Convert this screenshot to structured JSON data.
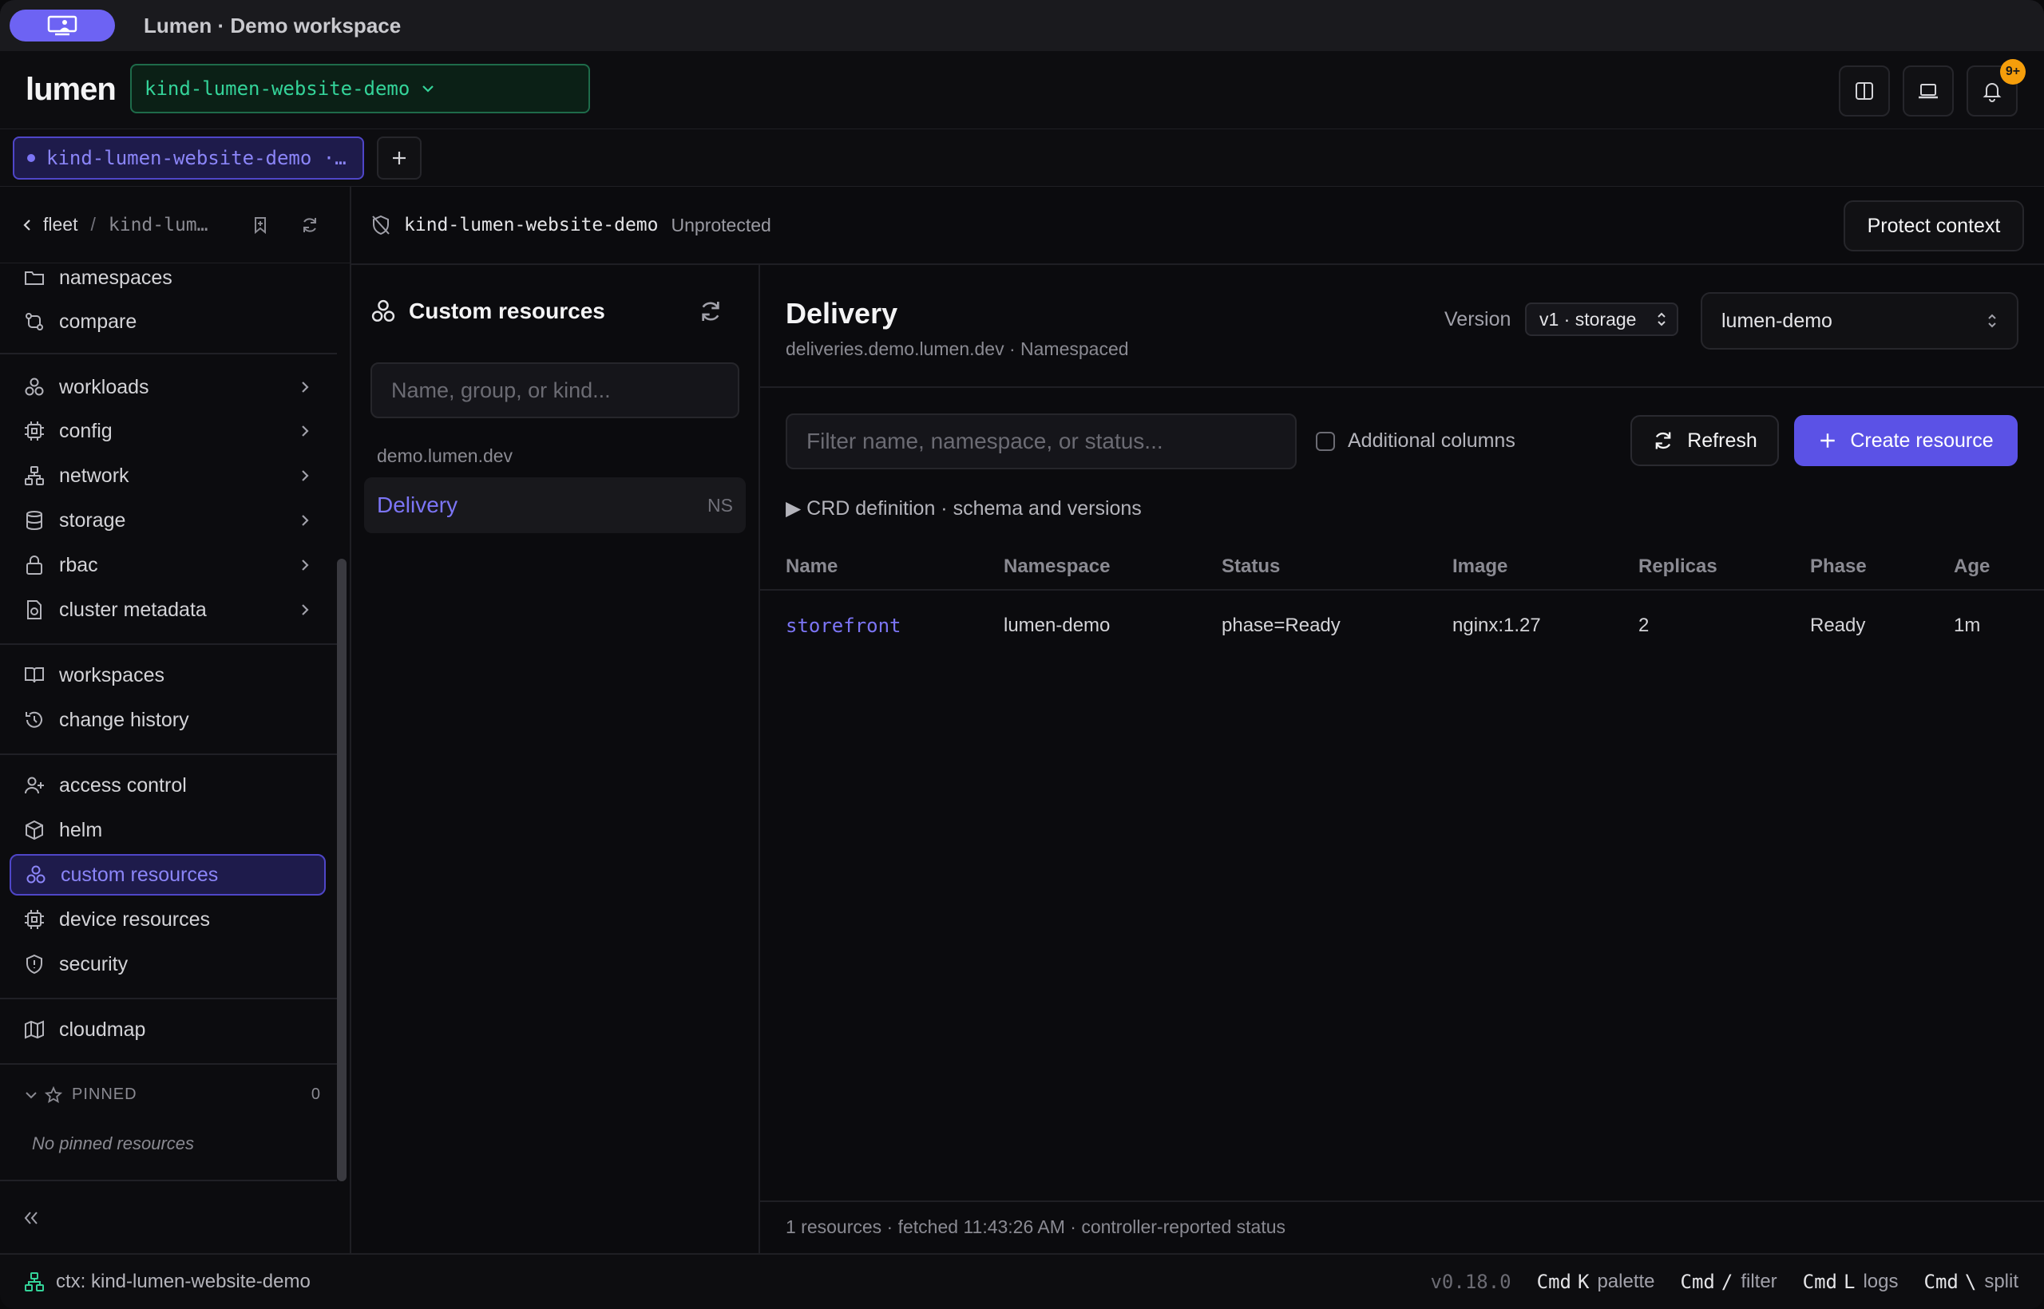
{
  "window": {
    "title": "Lumen · Demo workspace"
  },
  "appbar": {
    "brand": "lumen",
    "context": "kind-lumen-website-demo",
    "notification_badge": "9+"
  },
  "tabs": {
    "active_label": "kind-lumen-website-demo ·…"
  },
  "sidebar": {
    "breadcrumb": {
      "parent": "fleet",
      "separator": "/",
      "current": "kind-lum…"
    },
    "items": [
      {
        "label": "namespaces",
        "icon": "folder-icon"
      },
      {
        "label": "compare",
        "icon": "compare-icon"
      },
      {
        "label": "workloads",
        "icon": "workloads-icon"
      },
      {
        "label": "config",
        "icon": "config-icon"
      },
      {
        "label": "network",
        "icon": "network-icon"
      },
      {
        "label": "storage",
        "icon": "database-icon"
      },
      {
        "label": "rbac",
        "icon": "lock-icon"
      },
      {
        "label": "cluster metadata",
        "icon": "cluster-metadata-icon"
      },
      {
        "label": "workspaces",
        "icon": "workspaces-icon"
      },
      {
        "label": "change history",
        "icon": "history-icon"
      },
      {
        "label": "access control",
        "icon": "user-plus-icon"
      },
      {
        "label": "helm",
        "icon": "package-icon"
      },
      {
        "label": "custom resources",
        "icon": "custom-resources-icon"
      },
      {
        "label": "device resources",
        "icon": "chip-icon"
      },
      {
        "label": "security",
        "icon": "shield-icon"
      },
      {
        "label": "cloudmap",
        "icon": "map-icon"
      }
    ],
    "pinned": {
      "label": "PINNED",
      "count": "0",
      "empty_text": "No pinned resources"
    }
  },
  "context_header": {
    "name": "kind-lumen-website-demo",
    "status": "Unprotected",
    "protect_label": "Protect context"
  },
  "crd_panel": {
    "title": "Custom resources",
    "search_placeholder": "Name, group, or kind...",
    "group": "demo.lumen.dev",
    "items": [
      {
        "label": "Delivery",
        "scope": "NS"
      }
    ]
  },
  "main": {
    "title": "Delivery",
    "subtitle": "deliveries.demo.lumen.dev · Namespaced",
    "version_label": "Version",
    "version_value": "v1 · storage",
    "namespace_value": "lumen-demo",
    "filter_placeholder": "Filter name, namespace, or status...",
    "additional_columns_label": "Additional columns",
    "refresh_label": "Refresh",
    "create_label": "Create resource",
    "crd_toggle": "▶ CRD definition · schema and versions",
    "table": {
      "columns": [
        "Name",
        "Namespace",
        "Status",
        "Image",
        "Replicas",
        "Phase",
        "Age"
      ],
      "rows": [
        [
          "storefront",
          "lumen-demo",
          "phase=Ready",
          "nginx:1.27",
          "2",
          "Ready",
          "1m"
        ]
      ]
    },
    "footer": "1 resources · fetched 11:43:26 AM · controller-reported status"
  },
  "statusbar": {
    "context": "ctx: kind-lumen-website-demo",
    "version": "v0.18.0",
    "shortcuts": [
      {
        "mod": "Cmd",
        "key": "K",
        "label": "palette"
      },
      {
        "mod": "Cmd",
        "key": "/",
        "label": "filter"
      },
      {
        "mod": "Cmd",
        "key": "L",
        "label": "logs"
      },
      {
        "mod": "Cmd",
        "key": "\\",
        "label": "split"
      }
    ]
  },
  "colors": {
    "accent": "#5b52e6",
    "accent_text": "#7c75f5",
    "context_green": "#34d399",
    "badge": "#f59e0b"
  }
}
